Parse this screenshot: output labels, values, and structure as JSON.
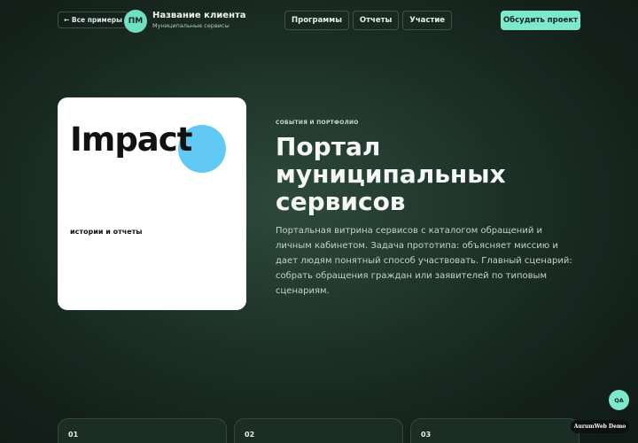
{
  "header": {
    "back_label": "← Все примеры",
    "logo_initials": "ПМ",
    "client_name": "Название клиента",
    "client_subtitle": "Муниципальные сервисы",
    "nav": [
      "Программы",
      "Отчеты",
      "Участие"
    ],
    "cta_label": "Обсудить проект"
  },
  "hero": {
    "card_word": "Impact",
    "card_caption": "истории и отчеты",
    "eyebrow": "СОБЫТИЯ И ПОРТФОЛИО",
    "title": "Портал муниципальных сервисов",
    "description": "Портальная витрина сервисов с каталогом обращений и личным кабинетом. Задача прототипа: объясняет миссию и дает людям понятный способ участвовать. Главный сценарий: собрать обращения граждан или заявителей по типовым сценариям."
  },
  "steps": [
    "01",
    "02",
    "03"
  ],
  "floating": {
    "qa_label": "QA",
    "demo_label": "AurumWeb Demo"
  },
  "colors": {
    "accent": "#7ee8cc",
    "circle": "#62c9f4",
    "background": "#14211b"
  }
}
